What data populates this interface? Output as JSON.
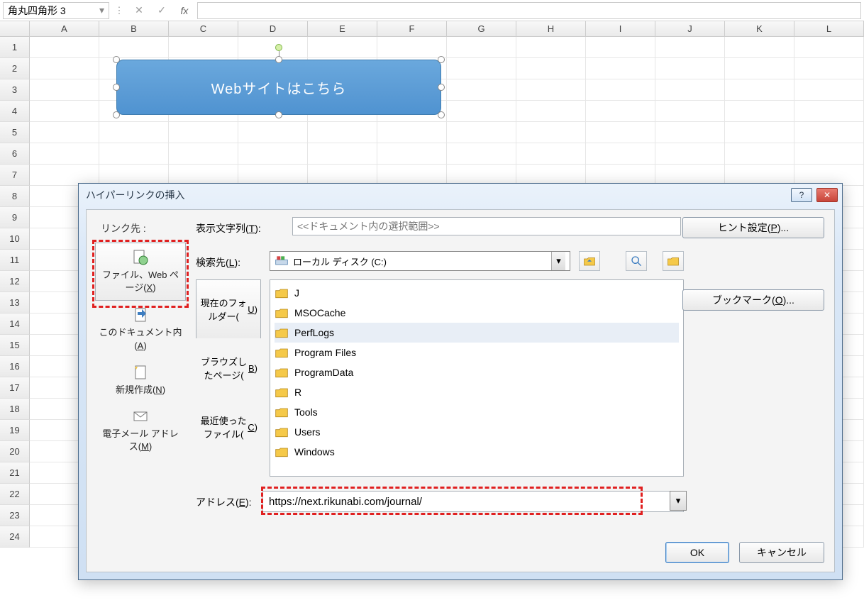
{
  "name_box": "角丸四角形 3",
  "columns": [
    "A",
    "B",
    "C",
    "D",
    "E",
    "F",
    "G",
    "H",
    "I",
    "J",
    "K",
    "L"
  ],
  "rows": [
    "1",
    "2",
    "3",
    "4",
    "5",
    "6",
    "7",
    "8",
    "9",
    "10",
    "11",
    "12",
    "13",
    "14",
    "15",
    "16",
    "17",
    "18",
    "19",
    "20",
    "21",
    "22",
    "23",
    "24"
  ],
  "shape": {
    "text": "Webサイトはこちら"
  },
  "dialog": {
    "title": "ハイパーリンクの挿入",
    "link_to_label": "リンク先 :",
    "display_label": "表示文字列(T):",
    "display_placeholder": "<<ドキュメント内の選択範囲>>",
    "hint_button": "ヒント設定(P)...",
    "sidebar": {
      "file_web": "ファイル、Web ページ(X)",
      "this_doc": "このドキュメント内(A)",
      "new_doc": "新規作成(N)",
      "email": "電子メール アドレス(M)"
    },
    "lookin_label": "検索先(L):",
    "lookin_value": "ローカル ディスク (C:)",
    "browse_btns": {
      "current": "現在のフォルダー(U)",
      "browsed": "ブラウズしたページ(B)",
      "recent": "最近使ったファイル(C)"
    },
    "files": [
      "J",
      "MSOCache",
      "PerfLogs",
      "Program Files",
      "ProgramData",
      "R",
      "Tools",
      "Users",
      "Windows"
    ],
    "bookmark_button": "ブックマーク(O)...",
    "address_label": "アドレス(E):",
    "address_value": "https://next.rikunabi.com/journal/",
    "ok": "OK",
    "cancel": "キャンセル"
  }
}
